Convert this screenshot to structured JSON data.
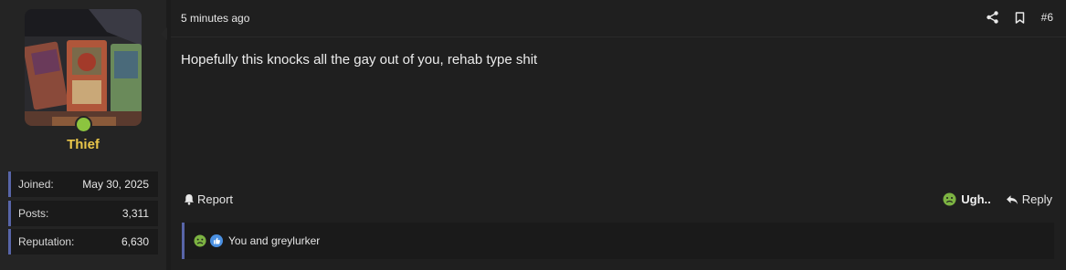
{
  "user": {
    "name": "Thief",
    "status": "online",
    "stats": [
      {
        "label": "Joined:",
        "value": "May 30, 2025"
      },
      {
        "label": "Posts:",
        "value": "3,311"
      },
      {
        "label": "Reputation:",
        "value": "6,630"
      }
    ]
  },
  "post": {
    "timestamp": "5 minutes ago",
    "number": "#6",
    "body": "Hopefully this knocks all the gay out of you, rehab type shit"
  },
  "actions": {
    "report_label": "Report",
    "reaction_label": "Ugh..",
    "reply_label": "Reply"
  },
  "reactions": {
    "summary": "You and greylurker",
    "icons": [
      "sick-reaction-icon",
      "like-reaction-icon"
    ]
  },
  "colors": {
    "username": "#e9c64a",
    "online": "#8cc43f",
    "accent": "#5865a8",
    "sick_green": "#7cb342",
    "like_blue": "#4a90e2"
  }
}
